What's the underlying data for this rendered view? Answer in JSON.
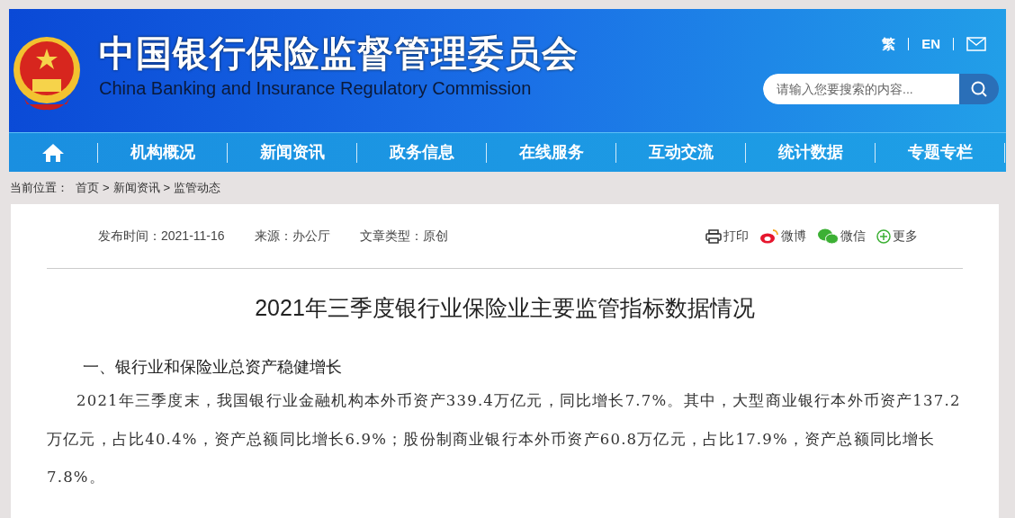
{
  "header": {
    "title": "中国银行保险监督管理委员会",
    "subtitle": "China Banking and Insurance Regulatory Commission",
    "links": [
      "繁",
      "EN"
    ],
    "search": {
      "placeholder": "请输入您要搜索的内容..."
    }
  },
  "nav": {
    "items": [
      {
        "kind": "home"
      },
      {
        "kind": "text",
        "label": "机构概况"
      },
      {
        "kind": "text",
        "label": "新闻资讯"
      },
      {
        "kind": "text",
        "label": "政务信息"
      },
      {
        "kind": "text",
        "label": "在线服务"
      },
      {
        "kind": "text",
        "label": "互动交流"
      },
      {
        "kind": "text",
        "label": "统计数据"
      },
      {
        "kind": "text",
        "label": "专题专栏"
      }
    ]
  },
  "breadcrumb": {
    "prefix": "当前位置：",
    "items": [
      "首页",
      "新闻资讯",
      "监管动态"
    ],
    "separator": ">"
  },
  "article": {
    "meta": [
      "发布时间：2021-11-16",
      "来源：办公厅",
      "文章类型：原创"
    ],
    "share": [
      {
        "kind": "print",
        "label": "打印"
      },
      {
        "kind": "weibo",
        "label": "微博"
      },
      {
        "kind": "wechat",
        "label": "微信"
      },
      {
        "kind": "more",
        "label": "更多"
      }
    ],
    "title": "2021年三季度银行业保险业主要监管指标数据情况",
    "heading": "一、银行业和保险业总资产稳健增长",
    "paragraph": "2021年三季度末，我国银行业金融机构本外币资产339.4万亿元，同比增长7.7%。其中，大型商业银行本外币资产137.2万亿元，占比40.4%，资产总额同比增长6.9%；股份制商业银行本外币资产60.8万亿元，占比17.9%，资产总额同比增长7.8%。"
  }
}
